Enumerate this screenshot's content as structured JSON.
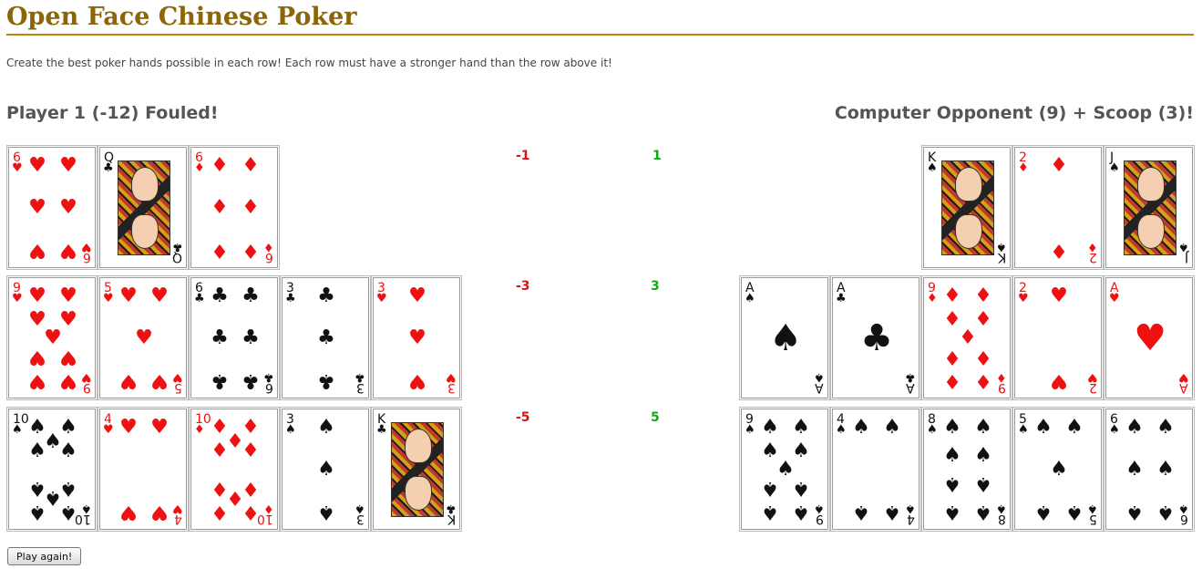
{
  "title": "Open Face Chinese Poker",
  "subtitle": "Create the best poker hands possible in each row! Each row must have a stronger hand than the row above it!",
  "player1": {
    "heading": "Player 1 (-12) Fouled!"
  },
  "player2": {
    "heading": "Computer Opponent (9) + Scoop (3)!"
  },
  "scores": [
    {
      "p1": "-1",
      "p2": "1"
    },
    {
      "p1": "-3",
      "p2": "3"
    },
    {
      "p1": "-5",
      "p2": "5"
    }
  ],
  "button": {
    "play_again": "Play again!"
  },
  "suits": {
    "H": "♥",
    "D": "♦",
    "C": "♣",
    "S": "♠"
  },
  "colors": {
    "title": "#8b6508",
    "red": "#ee1111",
    "black": "#111111",
    "negative": "#dd1111",
    "positive": "#11aa11"
  },
  "cards": {
    "player1": [
      [
        {
          "rank": "6",
          "suit": "H"
        },
        {
          "rank": "Q",
          "suit": "C"
        },
        {
          "rank": "6",
          "suit": "D"
        }
      ],
      [
        {
          "rank": "9",
          "suit": "H"
        },
        {
          "rank": "5",
          "suit": "H"
        },
        {
          "rank": "6",
          "suit": "C"
        },
        {
          "rank": "3",
          "suit": "C"
        },
        {
          "rank": "3",
          "suit": "H"
        }
      ],
      [
        {
          "rank": "10",
          "suit": "S"
        },
        {
          "rank": "4",
          "suit": "H"
        },
        {
          "rank": "10",
          "suit": "D"
        },
        {
          "rank": "3",
          "suit": "S"
        },
        {
          "rank": "K",
          "suit": "C"
        }
      ]
    ],
    "player2": [
      [
        {
          "rank": "K",
          "suit": "S"
        },
        {
          "rank": "2",
          "suit": "D"
        },
        {
          "rank": "J",
          "suit": "S"
        }
      ],
      [
        {
          "rank": "A",
          "suit": "S"
        },
        {
          "rank": "A",
          "suit": "C"
        },
        {
          "rank": "9",
          "suit": "D"
        },
        {
          "rank": "2",
          "suit": "H"
        },
        {
          "rank": "A",
          "suit": "H"
        }
      ],
      [
        {
          "rank": "9",
          "suit": "S"
        },
        {
          "rank": "4",
          "suit": "S"
        },
        {
          "rank": "8",
          "suit": "S"
        },
        {
          "rank": "5",
          "suit": "S"
        },
        {
          "rank": "6",
          "suit": "S"
        }
      ]
    ]
  }
}
